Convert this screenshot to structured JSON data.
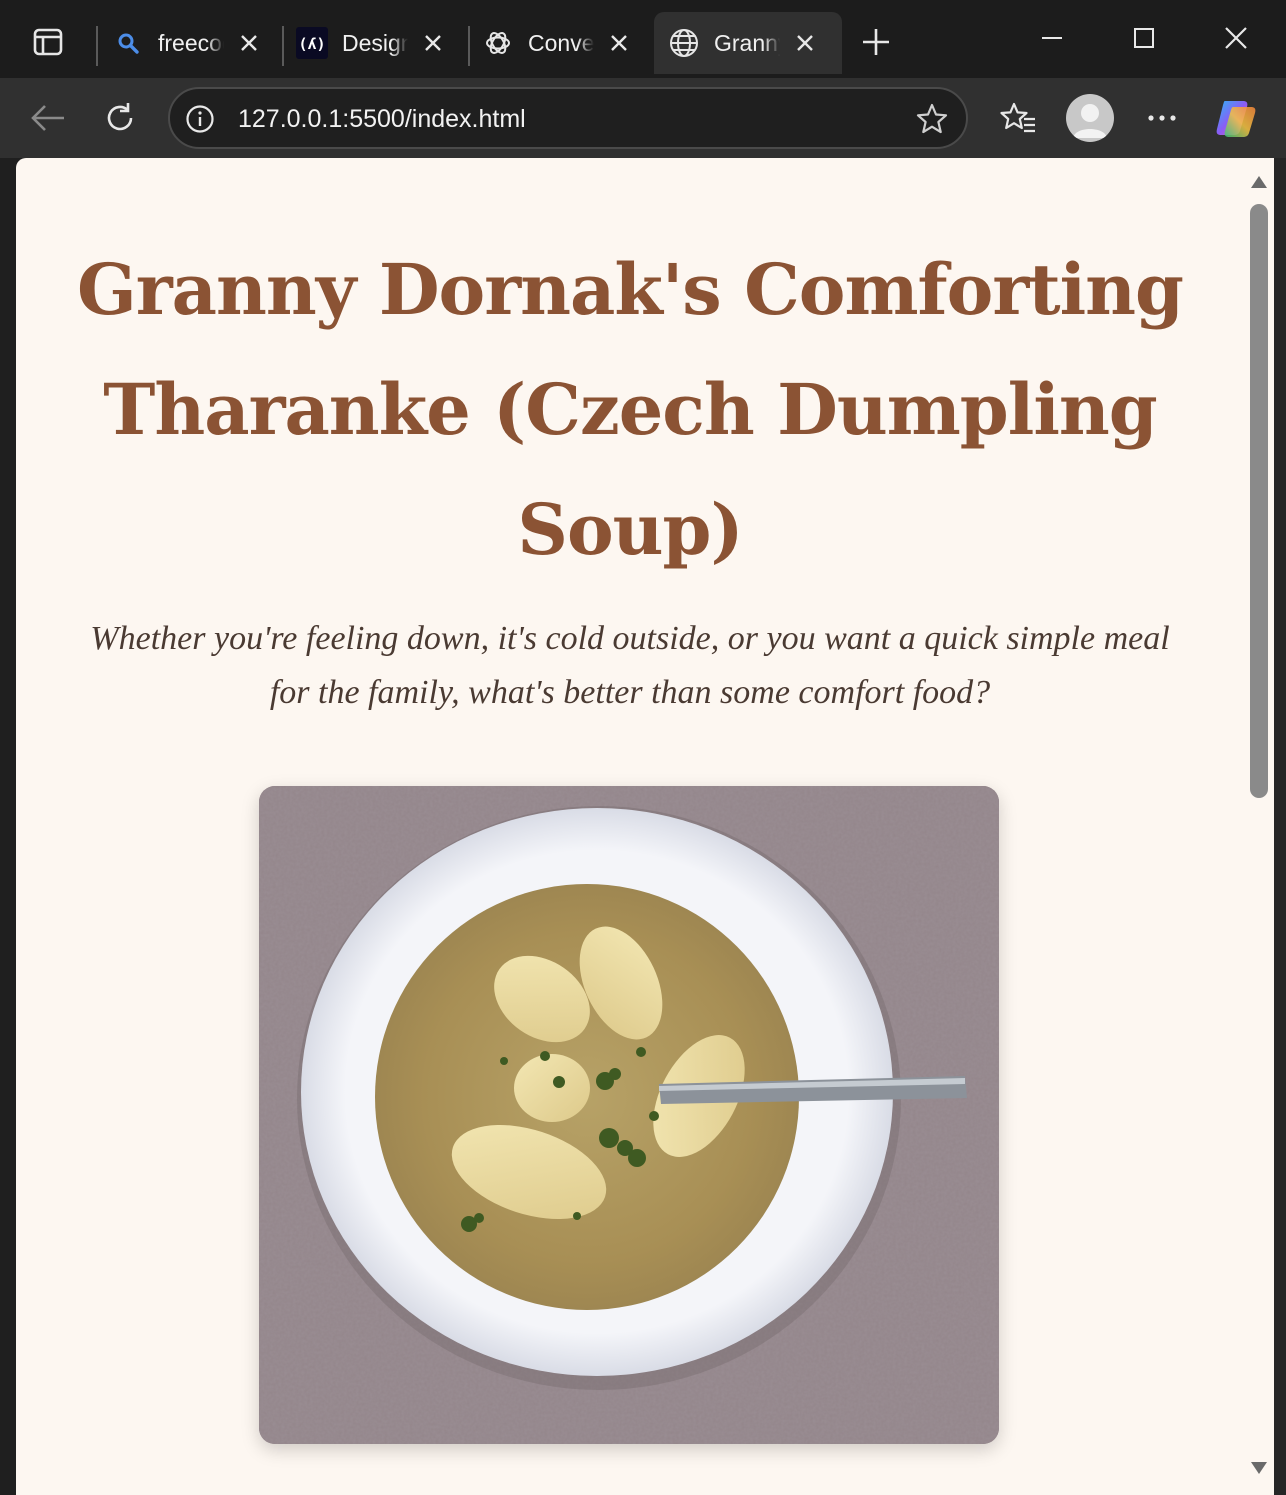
{
  "browser": {
    "tabs": [
      {
        "title": "freecodecamp",
        "icon": "search-icon",
        "active": false
      },
      {
        "title": "Design",
        "icon": "freecodecamp-icon",
        "active": false
      },
      {
        "title": "Conversation",
        "icon": "chatgpt-icon",
        "active": false
      },
      {
        "title": "Granny",
        "icon": "globe-icon",
        "active": true
      }
    ],
    "url": "127.0.0.1:5500/index.html"
  },
  "page": {
    "title": "Granny Dornak's Comforting Tharanke (Czech Dumpling Soup)",
    "intro": "Whether you're feeling down, it's cold outside, or you want a quick simple meal for the family, what's better than some comfort food?",
    "image_description": "bowl-of-dumpling-soup-photo"
  },
  "colors": {
    "title": "#8b5334",
    "page_background": "#fdf7f1",
    "intro_text": "#4a3a32"
  }
}
